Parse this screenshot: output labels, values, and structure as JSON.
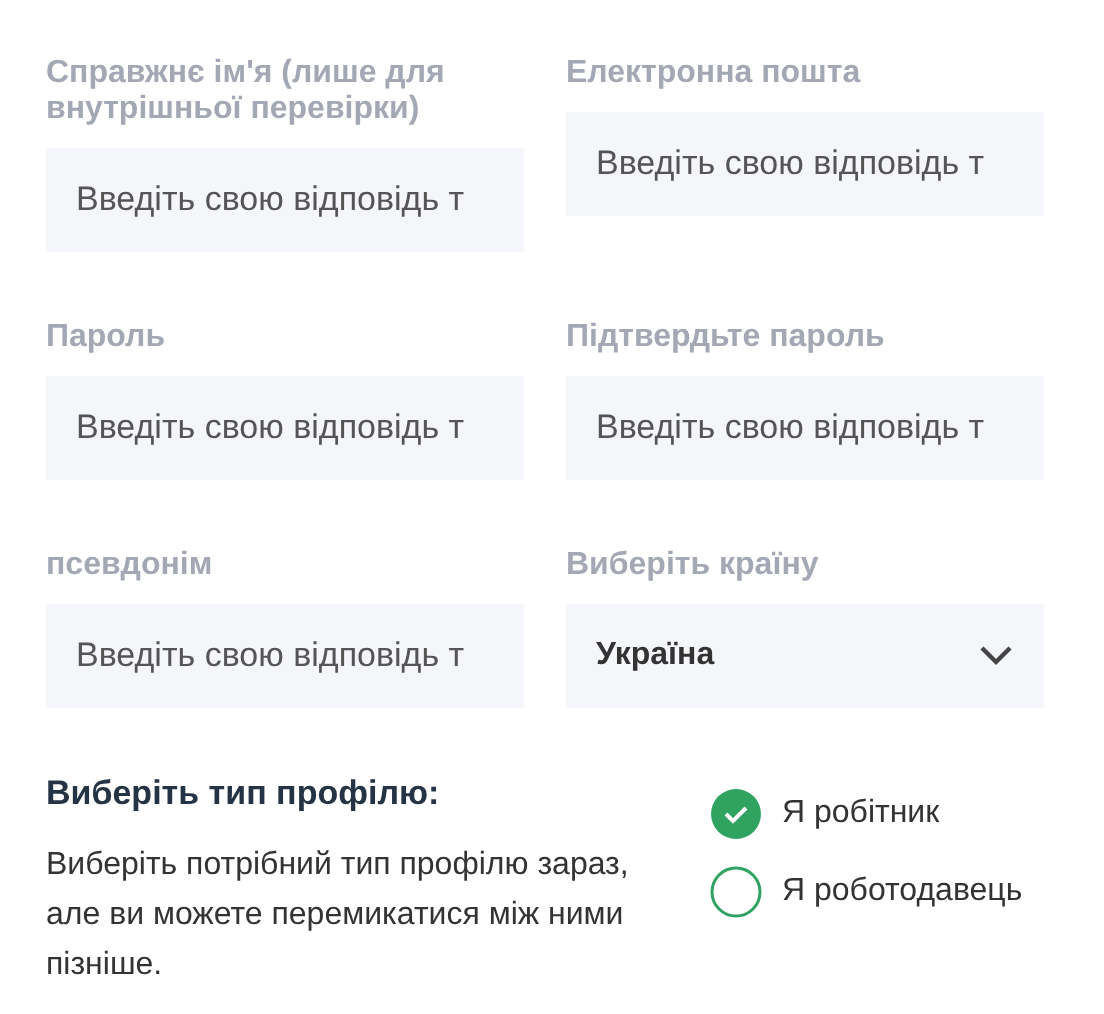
{
  "fields": [
    {
      "label": "Справжнє ім'я (лише для внутрішньої перевірки)",
      "kind": "text",
      "placeholder": "Введіть свою відповідь т"
    },
    {
      "label": "Електронна пошта",
      "kind": "text",
      "placeholder": "Введіть свою відповідь т"
    },
    {
      "label": "Пароль",
      "kind": "text",
      "placeholder": "Введіть свою відповідь т"
    },
    {
      "label": "Підтвердьте пароль",
      "kind": "text",
      "placeholder": "Введіть свою відповідь т"
    },
    {
      "label": "псевдонім",
      "kind": "text",
      "placeholder": "Введіть свою відповідь т"
    },
    {
      "label": "Виберіть країну",
      "kind": "select",
      "value": "Україна"
    }
  ],
  "profile": {
    "title": "Виберіть тип профілю:",
    "description": "Виберіть потрібний тип профілю зараз, але ви можете перемикатися між ними пізніше.",
    "options": [
      {
        "label": "Я робітник",
        "selected": true
      },
      {
        "label": "Я роботодавець",
        "selected": false
      }
    ]
  }
}
